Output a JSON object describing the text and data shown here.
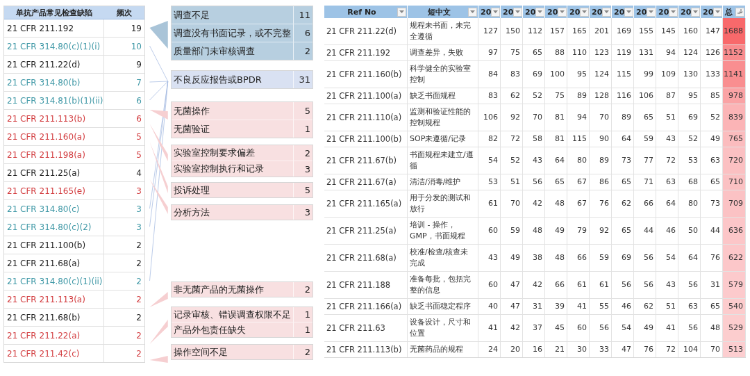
{
  "defects_table": {
    "header": {
      "title": "单抗产品常见检查缺陷",
      "count": "频次"
    },
    "rows": [
      {
        "code": "21 CFR 211.192",
        "count": "19",
        "color": "#222222"
      },
      {
        "code": "21 CFR 314.80(c)(1)(i)",
        "count": "10",
        "color": "#3f98a6"
      },
      {
        "code": "21 CFR 211.22(d)",
        "count": "9",
        "color": "#222222"
      },
      {
        "code": "21 CFR 314.80(b)",
        "count": "7",
        "color": "#3f98a6"
      },
      {
        "code": "21 CFR 314.81(b)(1)(ii)",
        "count": "6",
        "color": "#3f98a6"
      },
      {
        "code": "21 CFR 211.113(b)",
        "count": "6",
        "color": "#d23b3e"
      },
      {
        "code": "21 CFR 211.160(a)",
        "count": "5",
        "color": "#d23b3e"
      },
      {
        "code": "21 CFR 211.198(a)",
        "count": "5",
        "color": "#d23b3e"
      },
      {
        "code": "21 CFR 211.25(a)",
        "count": "4",
        "color": "#222222"
      },
      {
        "code": "21 CFR 211.165(e)",
        "count": "3",
        "color": "#d23b3e"
      },
      {
        "code": "21 CFR 314.80(c)",
        "count": "3",
        "color": "#3f98a6"
      },
      {
        "code": "21 CFR 314.80(c)(2)",
        "count": "3",
        "color": "#3f98a6"
      },
      {
        "code": "21 CFR 211.100(b)",
        "count": "2",
        "color": "#222222"
      },
      {
        "code": "21 CFR 211.68(a)",
        "count": "2",
        "color": "#222222"
      },
      {
        "code": "21 CFR 314.80(c)(1)(ii)",
        "count": "2",
        "color": "#3f98a6"
      },
      {
        "code": "21 CFR 211.113(a)",
        "count": "2",
        "color": "#d23b3e"
      },
      {
        "code": "21 CFR 211.68(b)",
        "count": "2",
        "color": "#222222"
      },
      {
        "code": "21 CFR 211.22(a)",
        "count": "2",
        "color": "#d23b3e"
      },
      {
        "code": "21 CFR 211.42(c)",
        "count": "2",
        "color": "#d23b3e"
      }
    ]
  },
  "categories": [
    {
      "color": "#b7cfe0",
      "items": [
        {
          "label": "调查不足",
          "count": "11"
        },
        {
          "label": "调查没有书面记录，或不完整",
          "count": "6"
        },
        {
          "label": "质量部门未审核调查",
          "count": "2"
        }
      ]
    },
    {
      "color": "#d9e1f2",
      "items": [
        {
          "label": "不良反应报告或BPDR",
          "count": "31"
        }
      ]
    },
    {
      "color": "#f8e0e1",
      "items": [
        {
          "label": "无菌操作",
          "count": "5"
        },
        {
          "label": "无菌验证",
          "count": "1"
        }
      ]
    },
    {
      "color": "#f8e0e1",
      "items": [
        {
          "label": "实验室控制要求偏差",
          "count": "2"
        },
        {
          "label": "实验室控制执行和记录",
          "count": "3"
        }
      ]
    },
    {
      "color": "#f8e0e1",
      "items": [
        {
          "label": "投诉处理",
          "count": "5"
        }
      ]
    },
    {
      "color": "#f8e0e1",
      "items": [
        {
          "label": "分析方法",
          "count": "3"
        }
      ]
    },
    {
      "color": "#f8e0e1",
      "items": [
        {
          "label": "非无菌产品的无菌操作",
          "count": "2"
        }
      ]
    },
    {
      "color": "#f8e0e1",
      "items": [
        {
          "label": "记录审核、错误调查权限不足",
          "count": "1"
        },
        {
          "label": "产品外包责任缺失",
          "count": "1"
        }
      ]
    },
    {
      "color": "#f8e0e1",
      "items": [
        {
          "label": "操作空间不足",
          "count": "2"
        }
      ]
    }
  ],
  "citations_table": {
    "columns": [
      {
        "label": "Ref No",
        "kind": "filter"
      },
      {
        "label": "短中文",
        "kind": "filter"
      },
      {
        "label": "20",
        "kind": "filter"
      },
      {
        "label": "20",
        "kind": "filter"
      },
      {
        "label": "20",
        "kind": "filter"
      },
      {
        "label": "20",
        "kind": "filter"
      },
      {
        "label": "20",
        "kind": "filter"
      },
      {
        "label": "20",
        "kind": "filter"
      },
      {
        "label": "20",
        "kind": "filter"
      },
      {
        "label": "20",
        "kind": "filter"
      },
      {
        "label": "20",
        "kind": "filter"
      },
      {
        "label": "20",
        "kind": "filter"
      },
      {
        "label": "20",
        "kind": "filter"
      },
      {
        "label": "总",
        "kind": "sort"
      }
    ],
    "rows": [
      {
        "ref": "21 CFR 211.22(d)",
        "desc": "规程未书面，未完全遵循",
        "values": [
          "127",
          "150",
          "112",
          "157",
          "165",
          "201",
          "169",
          "155",
          "145",
          "160",
          "147"
        ],
        "total": "1688",
        "color": "#f8696b"
      },
      {
        "ref": "21 CFR 211.192",
        "desc": "调查差异，失败",
        "values": [
          "97",
          "75",
          "65",
          "88",
          "110",
          "123",
          "119",
          "131",
          "94",
          "124",
          "126"
        ],
        "total": "1152",
        "color": "#f98c8e"
      },
      {
        "ref": "21 CFR 211.160(b)",
        "desc": "科学健全的实验室控制",
        "values": [
          "84",
          "83",
          "69",
          "100",
          "95",
          "124",
          "115",
          "99",
          "109",
          "130",
          "133"
        ],
        "total": "1141",
        "color": "#f98e90"
      },
      {
        "ref": "21 CFR 211.100(a)",
        "desc": "缺乏书面规程",
        "values": [
          "83",
          "62",
          "52",
          "75",
          "89",
          "128",
          "116",
          "106",
          "87",
          "95",
          "85"
        ],
        "total": "978",
        "color": "#faa3a5"
      },
      {
        "ref": "21 CFR 211.110(a)",
        "desc": "监测和验证性能的控制规程",
        "values": [
          "106",
          "92",
          "70",
          "81",
          "94",
          "70",
          "89",
          "65",
          "51",
          "69",
          "52"
        ],
        "total": "839",
        "color": "#fbb4b6"
      },
      {
        "ref": "21 CFR 211.100(b)",
        "desc": "SOP未遵循/记录",
        "values": [
          "82",
          "72",
          "58",
          "81",
          "115",
          "90",
          "64",
          "59",
          "43",
          "52",
          "49"
        ],
        "total": "765",
        "color": "#fbbcbe"
      },
      {
        "ref": "21 CFR 211.67(b)",
        "desc": "书面规程未建立/遵循",
        "values": [
          "54",
          "52",
          "43",
          "64",
          "80",
          "89",
          "73",
          "77",
          "72",
          "53",
          "63"
        ],
        "total": "720",
        "color": "#fbc0c2"
      },
      {
        "ref": "21 CFR 211.67(a)",
        "desc": "清洁/消毒/维护",
        "values": [
          "53",
          "51",
          "56",
          "65",
          "67",
          "86",
          "65",
          "71",
          "63",
          "68",
          "65"
        ],
        "total": "710",
        "color": "#fbc1c3"
      },
      {
        "ref": "21 CFR 211.165(a)",
        "desc": "用于分发的测试和放行",
        "values": [
          "61",
          "70",
          "42",
          "48",
          "67",
          "76",
          "62",
          "66",
          "64",
          "80",
          "73"
        ],
        "total": "709",
        "color": "#fbc2c4"
      },
      {
        "ref": "21 CFR 211.25(a)",
        "desc": "培训 - 操作，GMP，书面规程",
        "values": [
          "60",
          "59",
          "48",
          "49",
          "79",
          "92",
          "65",
          "44",
          "46",
          "50",
          "44"
        ],
        "total": "636",
        "color": "#fcc6c8"
      },
      {
        "ref": "21 CFR 211.68(a)",
        "desc": "校准/检查/核查未完成",
        "values": [
          "43",
          "49",
          "38",
          "48",
          "66",
          "59",
          "69",
          "56",
          "54",
          "64",
          "76"
        ],
        "total": "622",
        "color": "#fcc7c9"
      },
      {
        "ref": "21 CFR 211.188",
        "desc": "准备每批，包括完整的信息",
        "values": [
          "60",
          "47",
          "42",
          "66",
          "61",
          "61",
          "56",
          "56",
          "43",
          "56",
          "31"
        ],
        "total": "579",
        "color": "#fccacc"
      },
      {
        "ref": "21 CFR 211.166(a)",
        "desc": "缺乏书面稳定程序",
        "values": [
          "40",
          "47",
          "31",
          "39",
          "41",
          "55",
          "46",
          "62",
          "51",
          "63",
          "65"
        ],
        "total": "540",
        "color": "#fccccd"
      },
      {
        "ref": "21 CFR 211.63",
        "desc": "设备设计，尺寸和位置",
        "values": [
          "41",
          "42",
          "37",
          "45",
          "60",
          "56",
          "54",
          "49",
          "41",
          "56",
          "48"
        ],
        "total": "529",
        "color": "#fccdce"
      },
      {
        "ref": "21 CFR 211.113(b)",
        "desc": "无菌药品的规程",
        "values": [
          "24",
          "20",
          "16",
          "21",
          "30",
          "33",
          "47",
          "76",
          "72",
          "104",
          "70"
        ],
        "total": "513",
        "color": "#fcced0"
      }
    ]
  }
}
